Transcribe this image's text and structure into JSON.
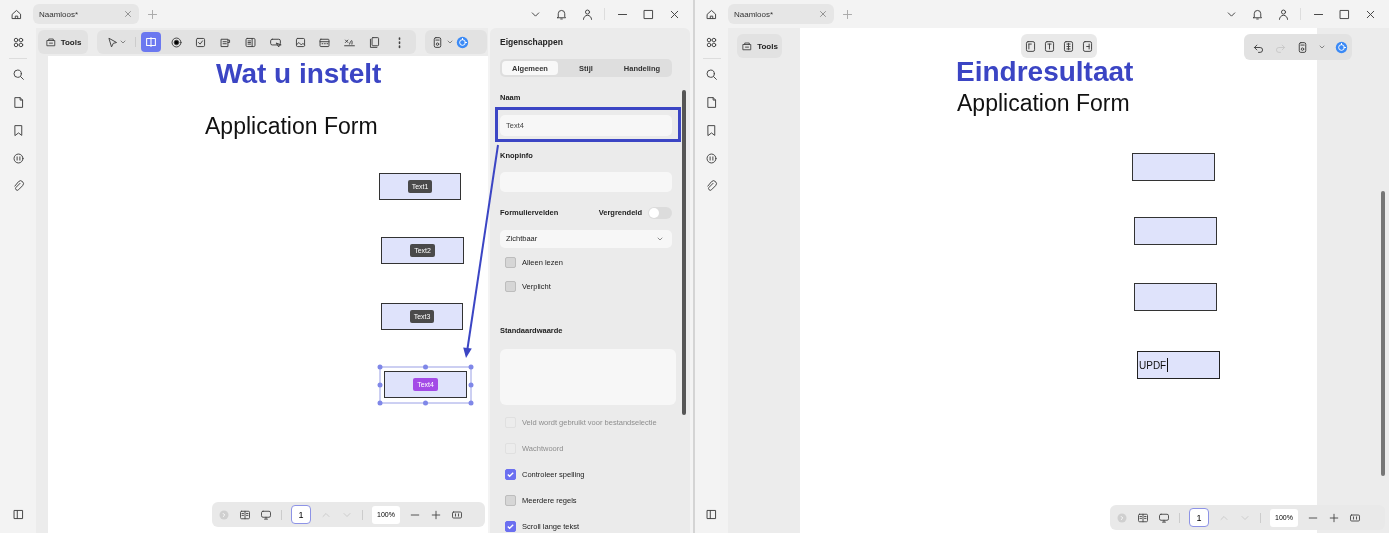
{
  "windows": [
    {
      "kind": "setup",
      "tab": "Naamloos*",
      "tools_label": "Tools",
      "tools": [
        {
          "kind": "pointer",
          "selected": false
        },
        {
          "kind": "text-field",
          "selected": true
        },
        {
          "kind": "radio",
          "selected": false
        },
        {
          "kind": "checkbox",
          "selected": false
        },
        {
          "kind": "dropdown",
          "selected": false
        },
        {
          "kind": "list-box",
          "selected": false
        },
        {
          "kind": "button",
          "selected": false
        },
        {
          "kind": "image",
          "selected": false
        },
        {
          "kind": "date",
          "selected": false
        },
        {
          "kind": "signature",
          "selected": false
        },
        {
          "kind": "pages",
          "selected": false
        },
        {
          "kind": "more",
          "selected": false
        }
      ],
      "page": {
        "heading": "Wat u instelt",
        "title": "Application Form",
        "fields": [
          {
            "label": "Text1",
            "selected": false
          },
          {
            "label": "Text2",
            "selected": false
          },
          {
            "label": "Text3",
            "selected": false
          },
          {
            "label": "Text4",
            "selected": true
          }
        ]
      },
      "properties": {
        "title": "Eigenschappen",
        "tabs": [
          {
            "label": "Algemeen",
            "selected": true
          },
          {
            "label": "Stijl",
            "selected": false
          },
          {
            "label": "Handeling",
            "selected": false
          }
        ],
        "name_label": "Naam",
        "name_value": "Text4",
        "tooltip_label": "Knopinfo",
        "form_fields_label": "Formuliervelden",
        "locked_label": "Vergrendeld",
        "locked": false,
        "visibility": "Zichtbaar",
        "options": [
          {
            "label": "Alleen lezen",
            "checked": false,
            "disabled": false
          },
          {
            "label": "Verplicht",
            "checked": false,
            "disabled": false
          }
        ],
        "default_label": "Standaardwaarde",
        "more_options": [
          {
            "label": "Veld wordt gebruikt voor bestandselectie",
            "checked": false,
            "disabled": true
          },
          {
            "label": "Wachtwoord",
            "checked": false,
            "disabled": true
          },
          {
            "label": "Controleer spelling",
            "checked": true,
            "disabled": false
          },
          {
            "label": "Meerdere regels",
            "checked": false,
            "disabled": false
          },
          {
            "label": "Scroll lange tekst",
            "checked": true,
            "disabled": false
          }
        ]
      },
      "page_number": "1",
      "zoom": "100%"
    },
    {
      "kind": "result",
      "tab": "Naamloos*",
      "tools_label": "Tools",
      "page": {
        "heading": "Eindresultaat",
        "title": "Application Form",
        "fields": [
          {
            "focused": false
          },
          {
            "focused": false
          },
          {
            "focused": false
          },
          {
            "focused": true,
            "value": "UPDF"
          }
        ]
      },
      "page_number": "1",
      "zoom": "100%"
    }
  ]
}
